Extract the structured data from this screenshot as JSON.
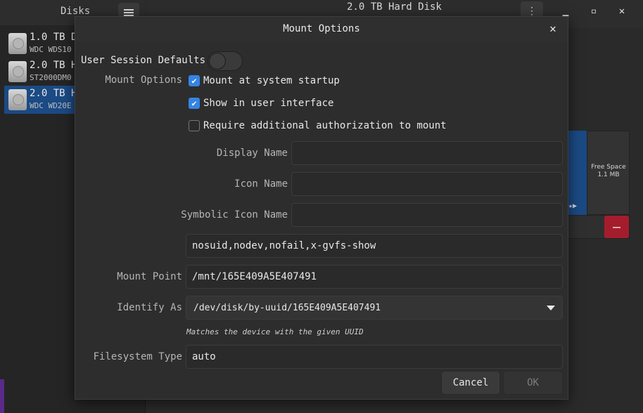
{
  "background": {
    "sidebar_title": "Disks",
    "window_title": "2.0 TB Hard Disk",
    "disks": [
      {
        "name": "1.0 TB D",
        "model": "WDC WDS10"
      },
      {
        "name": "2.0 TB H",
        "model": "ST2000DM0"
      },
      {
        "name": "2.0 TB H",
        "model": "WDC WD20E"
      }
    ],
    "free_space_label": "Free Space",
    "free_space_size": "1.1 MB"
  },
  "dialog": {
    "title": "Mount Options",
    "user_session_defaults_label": "User Session Defaults",
    "user_session_defaults_on": false,
    "mount_options_label": "Mount Options",
    "checkboxes": [
      {
        "label": "Mount at system startup",
        "checked": true
      },
      {
        "label": "Show in user interface",
        "checked": true
      },
      {
        "label": "Require additional authorization to mount",
        "checked": false
      }
    ],
    "display_name_label": "Display Name",
    "display_name_value": "",
    "icon_name_label": "Icon Name",
    "icon_name_value": "",
    "symbolic_icon_name_label": "Symbolic Icon Name",
    "symbolic_icon_name_value": "",
    "options_value": "nosuid,nodev,nofail,x-gvfs-show",
    "mount_point_label": "Mount Point",
    "mount_point_value": "/mnt/165E409A5E407491",
    "identify_as_label": "Identify As",
    "identify_as_value": "/dev/disk/by-uuid/165E409A5E407491",
    "identify_hint": "Matches the device with the given UUID",
    "filesystem_type_label": "Filesystem Type",
    "filesystem_type_value": "auto",
    "cancel_label": "Cancel",
    "ok_label": "OK"
  },
  "colors": {
    "accent": "#3584e4",
    "selection": "#1b4a84",
    "destructive": "#a51d2d"
  }
}
